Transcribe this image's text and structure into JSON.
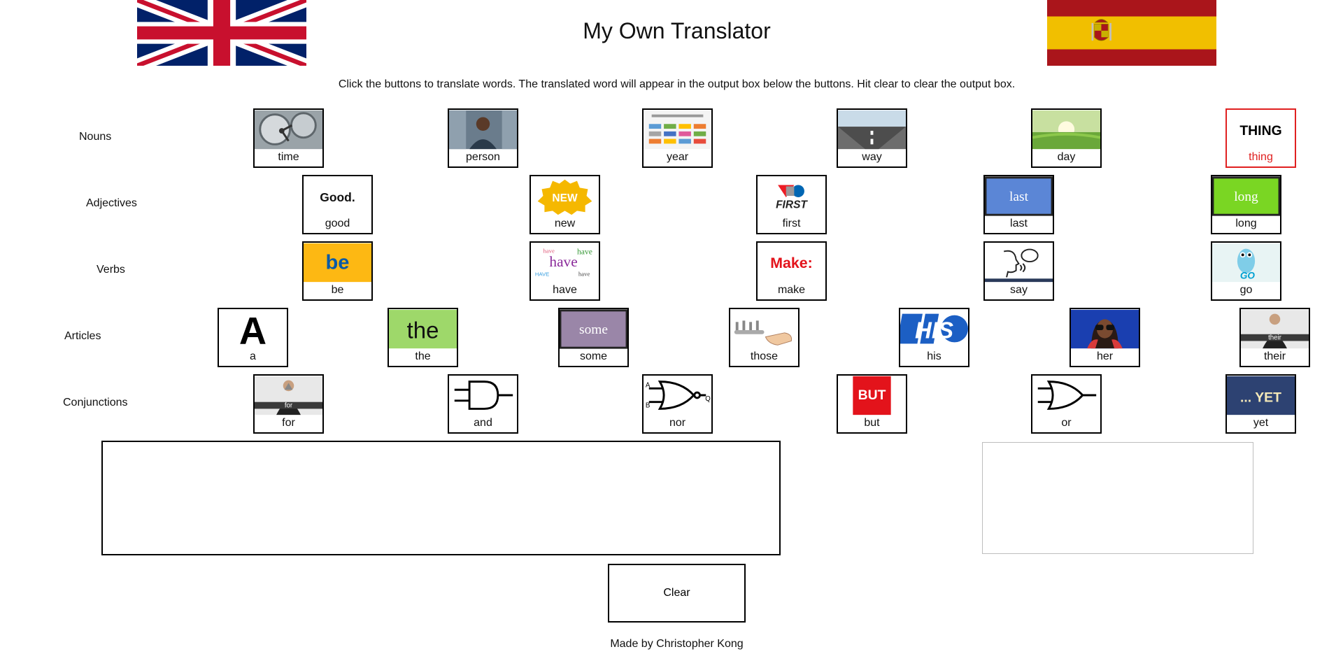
{
  "page": {
    "title": "My Own Translator",
    "instructions": "Click the buttons to translate words. The translated word will appear in the output box below the buttons. Hit clear to clear the output box.",
    "clear_label": "Clear",
    "footer": "Made by Christopher Kong"
  },
  "flags": {
    "source": "uk-flag-icon",
    "target": "spain-flag-icon"
  },
  "colors": {
    "accent_highlight": "#e02020",
    "border": "#000000"
  },
  "rows": {
    "nouns": {
      "label": "Nouns",
      "words": [
        {
          "label": "time",
          "icon": "clock-gears-icon"
        },
        {
          "label": "person",
          "icon": "person-photo-icon"
        },
        {
          "label": "year",
          "icon": "months-of-year-icon"
        },
        {
          "label": "way",
          "icon": "my-way-road-icon"
        },
        {
          "label": "day",
          "icon": "sunny-field-icon"
        },
        {
          "label": "thing",
          "icon": "thing-text-icon",
          "img_text": "THING"
        }
      ]
    },
    "adjectives": {
      "label": "Adjectives",
      "words": [
        {
          "label": "good",
          "icon": "good-text-icon",
          "img_text": "Good."
        },
        {
          "label": "new",
          "icon": "new-badge-icon",
          "img_text": "NEW"
        },
        {
          "label": "first",
          "icon": "first-robotics-logo-icon",
          "img_text": "FIRST"
        },
        {
          "label": "last",
          "icon": "last-text-icon",
          "img_text": "last"
        },
        {
          "label": "long",
          "icon": "long-text-icon",
          "img_text": "long"
        }
      ]
    },
    "verbs": {
      "label": "Verbs",
      "words": [
        {
          "label": "be",
          "icon": "be-logo-icon",
          "img_text": "be"
        },
        {
          "label": "have",
          "icon": "have-words-icon",
          "img_text": "have"
        },
        {
          "label": "make",
          "icon": "make-text-icon",
          "img_text": "Make:"
        },
        {
          "label": "say",
          "icon": "speaking-head-icon"
        },
        {
          "label": "go",
          "icon": "go-gopher-icon",
          "img_text": "GO"
        }
      ]
    },
    "articles": {
      "label": "Articles",
      "words": [
        {
          "label": "a",
          "icon": "letter-a-icon",
          "img_text": "A"
        },
        {
          "label": "the",
          "icon": "the-text-icon",
          "img_text": "the"
        },
        {
          "label": "some",
          "icon": "some-text-icon",
          "img_text": "some"
        },
        {
          "label": "those",
          "icon": "pointing-hand-icon"
        },
        {
          "label": "his",
          "icon": "his-logo-icon",
          "img_text": "HIS"
        },
        {
          "label": "her",
          "icon": "woman-binoculars-icon"
        },
        {
          "label": "their",
          "icon": "their-sign-person-icon",
          "img_text": "their"
        }
      ]
    },
    "conjunctions": {
      "label": "Conjunctions",
      "words": [
        {
          "label": "for",
          "icon": "for-sign-person-icon",
          "img_text": "for"
        },
        {
          "label": "and",
          "icon": "and-gate-icon"
        },
        {
          "label": "nor",
          "icon": "nor-gate-icon",
          "img_text": [
            "A",
            "B",
            "Q"
          ]
        },
        {
          "label": "but",
          "icon": "but-sign-icon",
          "img_text": "BUT"
        },
        {
          "label": "or",
          "icon": "or-gate-icon"
        },
        {
          "label": "yet",
          "icon": "yet-text-icon",
          "img_text": "... YET"
        }
      ]
    }
  },
  "output": {
    "english_value": "",
    "spanish_value": ""
  }
}
